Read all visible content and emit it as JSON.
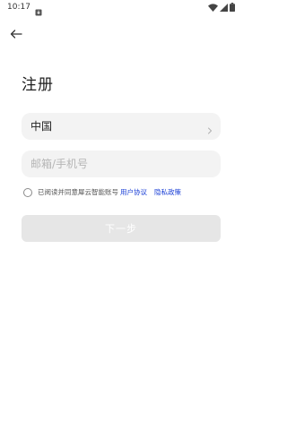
{
  "status_bar": {
    "time": "10:17",
    "notification_icon": "download-notification-icon",
    "wifi_icon": "wifi-icon",
    "signal_icon": "cell-signal-icon",
    "battery_icon": "battery-icon"
  },
  "header": {
    "back_icon": "arrow-left-icon"
  },
  "page": {
    "title": "注册"
  },
  "form": {
    "country_value": "中国",
    "country_chevron_icon": "chevron-right-icon",
    "account_value": "",
    "account_placeholder": "邮箱/手机号"
  },
  "agreement": {
    "text": "已阅读并同意犀云智能账号",
    "user_agreement_link": "用户协议",
    "privacy_policy_link": "隐私政策",
    "link_color": "#1a3fd6"
  },
  "actions": {
    "next_label": "下一步",
    "next_disabled_color": "#e6e6e6"
  }
}
